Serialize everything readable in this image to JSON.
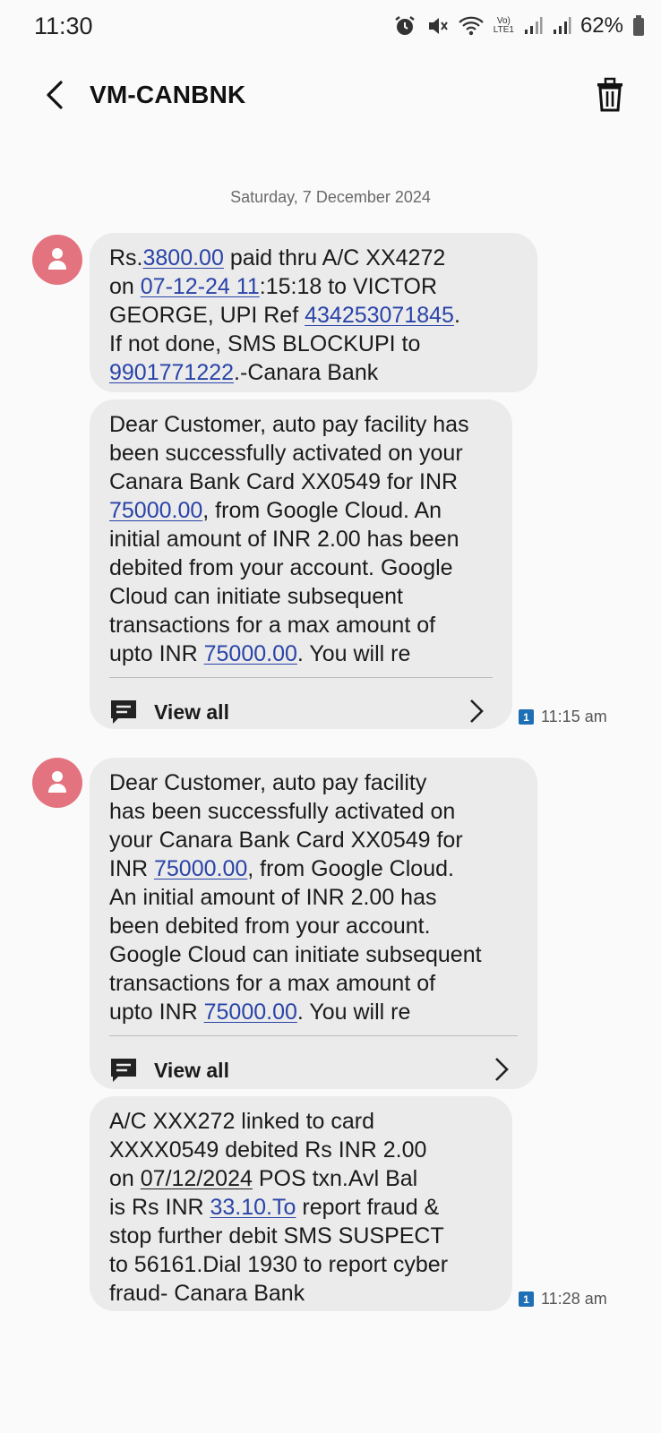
{
  "status_bar": {
    "time": "11:30",
    "battery": "62%",
    "volte_label": "Vo)\nLTE1",
    "icons": [
      "alarm-icon",
      "mute-icon",
      "wifi-icon",
      "volte-icon",
      "signal-icon",
      "signal-icon",
      "battery-icon"
    ]
  },
  "header": {
    "title": "VM-CANBNK",
    "back_icon": "back-arrow-icon",
    "delete_icon": "trash-icon"
  },
  "date_divider": "Saturday, 7 December 2024",
  "messages": [
    {
      "parts": [
        {
          "t": "Rs."
        },
        {
          "t": "3800.00",
          "link": true
        },
        {
          "t": " paid thru A/C XX4272\non "
        },
        {
          "t": "07-12-24 11",
          "link": true
        },
        {
          "t": ":15:18 to VICTOR\nGEORGE, UPI Ref "
        },
        {
          "t": "434253071845",
          "link": true
        },
        {
          "t": ".\nIf not done, SMS BLOCKUPI to\n"
        },
        {
          "t": "9901771222",
          "link": true
        },
        {
          "t": ".-Canara Bank"
        }
      ]
    },
    {
      "parts": [
        {
          "t": "Dear Customer, auto pay facility has\nbeen successfully activated on your\nCanara Bank Card XX0549 for INR\n"
        },
        {
          "t": "75000.00",
          "link": true
        },
        {
          "t": ", from Google Cloud. An\ninitial amount of INR 2.00 has been\ndebited from your account. Google\nCloud can initiate subsequent\ntransactions for a max amount of\nupto INR "
        },
        {
          "t": "75000.00",
          "link": true
        },
        {
          "t": ". You will re"
        }
      ],
      "view_all_label": "View all",
      "time": "11:15 am",
      "sim": "1"
    },
    {
      "parts": [
        {
          "t": "Dear Customer, auto pay facility\nhas been successfully activated on\nyour Canara Bank Card XX0549 for\nINR "
        },
        {
          "t": "75000.00",
          "link": true
        },
        {
          "t": ", from Google Cloud.\nAn initial amount of INR 2.00 has\nbeen debited from your account.\nGoogle Cloud can initiate subsequent\ntransactions for a max amount of\nupto INR "
        },
        {
          "t": "75000.00",
          "link": true
        },
        {
          "t": ". You will re"
        }
      ],
      "view_all_label": "View all"
    },
    {
      "parts": [
        {
          "t": "A/C XXX272 linked to card\nXXXX0549 debited Rs INR 2.00\non "
        },
        {
          "t": "07/12/2024",
          "underline": true
        },
        {
          "t": " POS txn.Avl Bal\nis Rs INR "
        },
        {
          "t": "33.10.To",
          "link": true
        },
        {
          "t": " report fraud &\nstop further debit SMS SUSPECT\nto 56161.Dial 1930 to report cyber\nfraud- Canara Bank"
        }
      ],
      "time": "11:28 am",
      "sim": "1"
    }
  ]
}
